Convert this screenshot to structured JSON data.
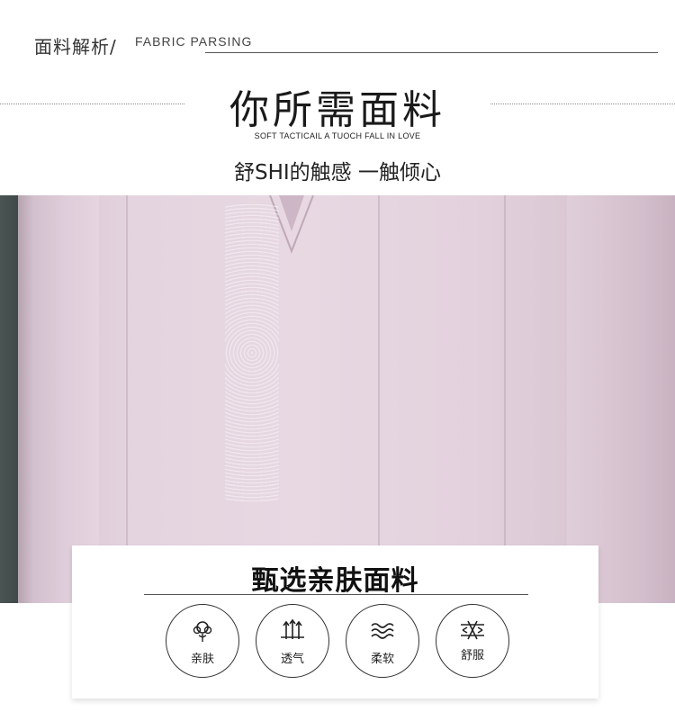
{
  "section": {
    "title_cn": "面料解析/",
    "title_en": "FABRIC PARSING"
  },
  "headline": {
    "title": "你所需面料",
    "subtitle_en": "SOFT TACTICAIL A TUOCH FALL IN LOVE",
    "subtitle_cn": "舒SHI的触感 一触倾心"
  },
  "photo": {
    "subject": "lilac-blouse-embroidered-placket"
  },
  "card": {
    "title": "甄选亲肤面料",
    "features": [
      {
        "label": "亲肤",
        "icon": "cotton-icon"
      },
      {
        "label": "透气",
        "icon": "breathable-arrows-icon"
      },
      {
        "label": "柔软",
        "icon": "soft-waves-icon"
      },
      {
        "label": "舒服",
        "icon": "comfort-arrows-icon"
      }
    ]
  },
  "colors": {
    "fabric": "#e6d6e0",
    "text": "#222222",
    "rule": "#555555"
  }
}
